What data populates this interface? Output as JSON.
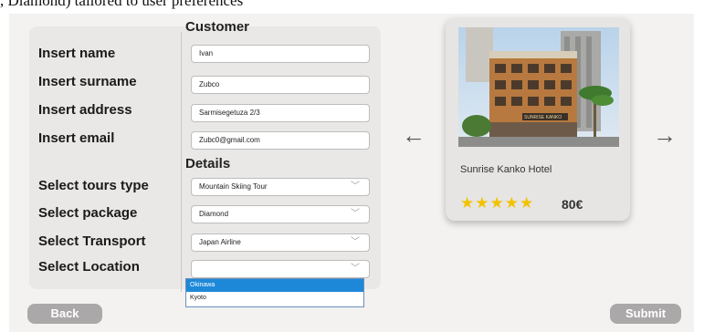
{
  "caption": ", Diamond) tailored to user preferences",
  "form": {
    "customer_title": "Customer",
    "details_title": "Details",
    "labels": {
      "name": "Insert name",
      "surname": "Insert surname",
      "address": "Insert address",
      "email": "Insert email",
      "tours_type": "Select tours type",
      "package": "Select package",
      "transport": "Select Transport",
      "location": "Select Location"
    },
    "values": {
      "name": "Ivan",
      "surname": "Zubco",
      "address": "Sarmisegetuza 2/3",
      "email": "Zubc0@gmail.com",
      "tours_type": "Mountain Skiing Tour",
      "package": "Diamond",
      "transport": "Japan Airline",
      "location": ""
    },
    "location_options": [
      "Okinawa",
      "Kyoto"
    ],
    "location_highlighted": "Okinawa"
  },
  "buttons": {
    "back": "Back",
    "submit": "Submit"
  },
  "carousel": {
    "prev": "←",
    "next": "→",
    "hotel_name": "Sunrise Kanko Hotel",
    "rating": 5,
    "stars_text": "★★★★★",
    "price": "80€",
    "hotel_sign_text": "SUNRISE KANKO"
  },
  "icons": {
    "chevron": "chevron-down-icon",
    "star": "star-icon",
    "prev": "arrow-left-icon",
    "next": "arrow-right-icon"
  }
}
